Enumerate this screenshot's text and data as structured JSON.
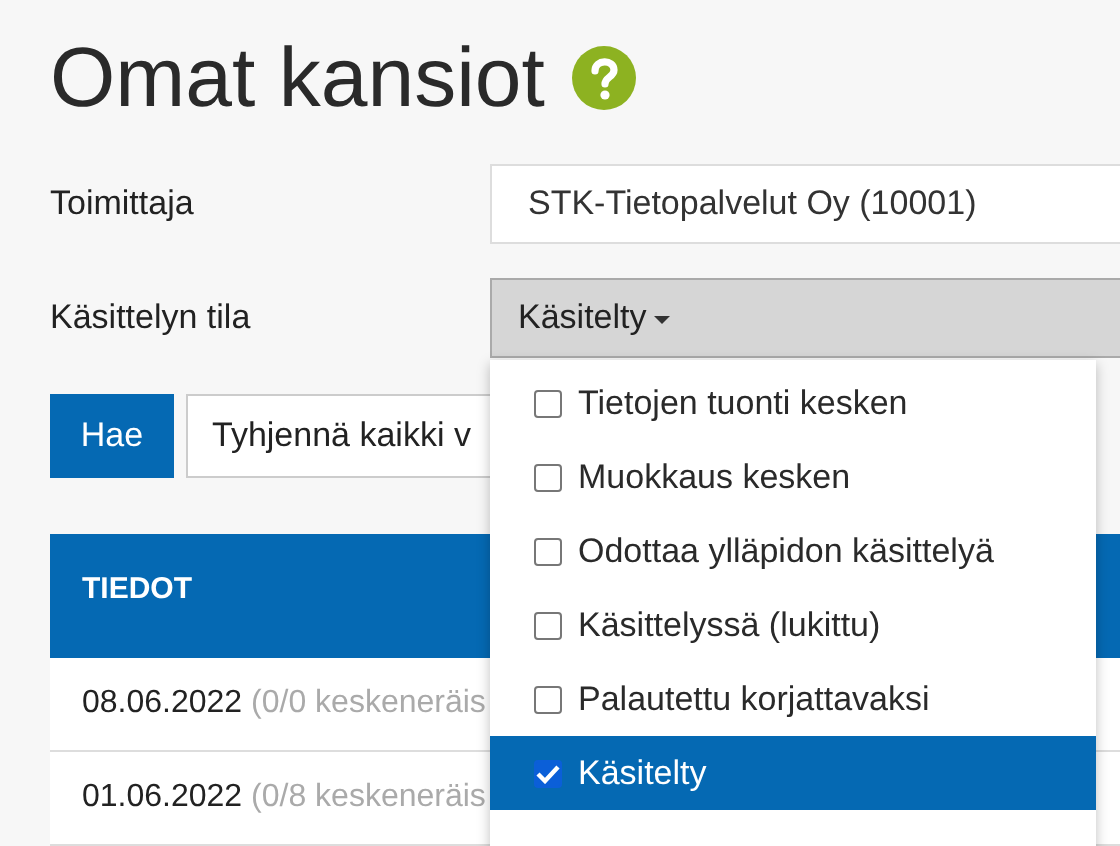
{
  "page": {
    "title": "Omat kansiot"
  },
  "filters": [
    {
      "label": "Toimittaja",
      "value": "STK-Tietopalvelut Oy (10001)",
      "kind": "select"
    },
    {
      "label": "Käsittelyn tila",
      "value": "Käsitelty",
      "kind": "dropdown",
      "expanded": true
    }
  ],
  "buttons": [
    {
      "label": "Hae",
      "kind": "primary"
    },
    {
      "label": "Tyhjennä kaikki v",
      "kind": "default"
    }
  ],
  "table": {
    "columns": [
      "TIEDOT"
    ],
    "rows": [
      {
        "date": "08.06.2022",
        "note": "(0/0 keskeneräis"
      },
      {
        "date": "01.06.2022",
        "note": "(0/8 keskeneräis"
      }
    ]
  },
  "status_options": [
    {
      "label": "Tietojen tuonti kesken",
      "checked": false
    },
    {
      "label": "Muokkaus kesken",
      "checked": false
    },
    {
      "label": "Odottaa ylläpidon käsittelyä",
      "checked": false
    },
    {
      "label": "Käsittelyssä (lukittu)",
      "checked": false
    },
    {
      "label": "Palautettu korjattavaksi",
      "checked": false
    },
    {
      "label": "Käsitelty",
      "checked": true
    }
  ]
}
